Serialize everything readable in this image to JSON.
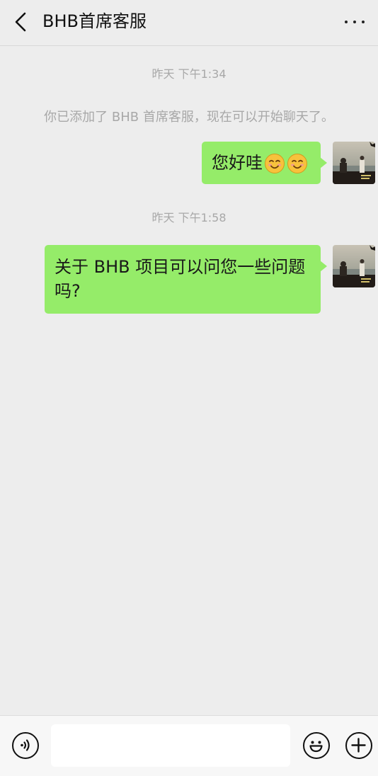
{
  "header": {
    "title": "BHB首席客服",
    "back_icon": "chevron-left-icon",
    "more_icon": "ellipsis-icon"
  },
  "messages": {
    "timestamp_1": "昨天 下午1:34",
    "system_notice": "你已添加了 BHB 首席客服，现在可以开始聊天了。",
    "msg_1": {
      "text": "您好哇",
      "emoji": [
        "smiling-face-icon",
        "smiling-face-icon"
      ]
    },
    "timestamp_2": "昨天 下午1:58",
    "msg_2": {
      "line_1": "关于 BHB 项目可以问您一些问题",
      "line_2": "吗?"
    }
  },
  "input_bar": {
    "voice_icon": "voice-icon",
    "message_value": "",
    "emoji_icon": "emoji-icon",
    "plus_icon": "plus-icon"
  },
  "colors": {
    "background": "#ededed",
    "bubble_green": "#95ec69",
    "muted_text": "#a8a8a8"
  }
}
